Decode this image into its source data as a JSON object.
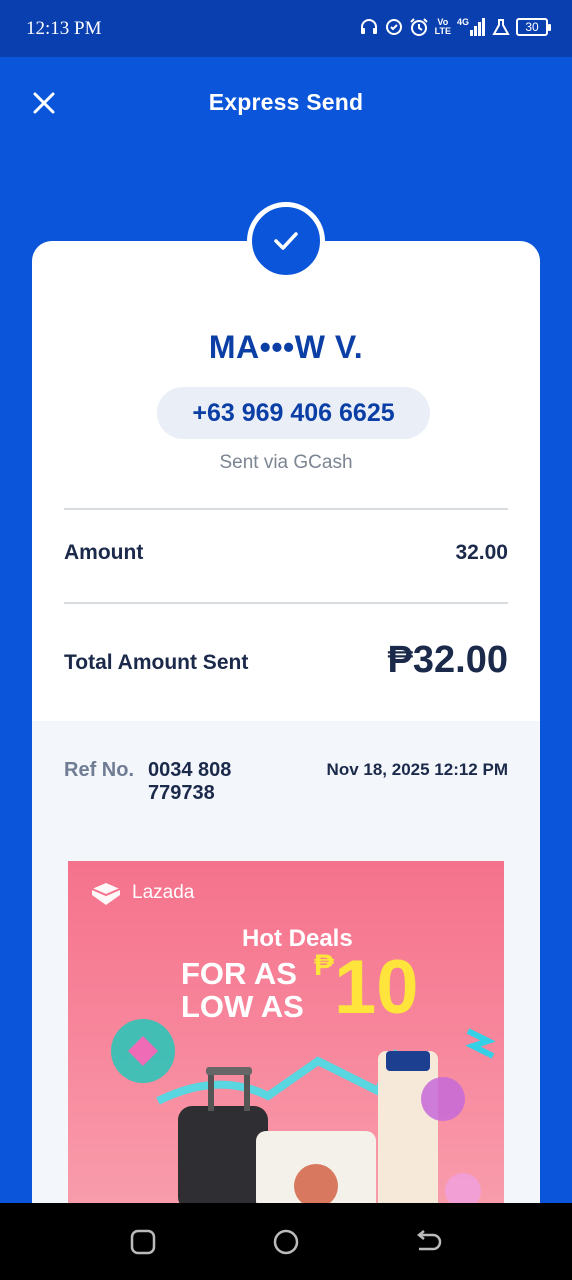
{
  "status_bar": {
    "time": "12:13 PM",
    "battery": "30",
    "net_top": "Vo",
    "net_bottom": "LTE",
    "signal_label": "4G"
  },
  "header": {
    "title": "Express Send"
  },
  "receipt": {
    "recipient_name": "MA•••W V.",
    "phone": "+63 969 406 6625",
    "sent_via": "Sent via GCash",
    "amount_label": "Amount",
    "amount_value": "32.00",
    "total_label": "Total Amount Sent",
    "total_value": "₱32.00",
    "ref_label": "Ref No.",
    "ref_number": "0034 808 779738",
    "date": "Nov 18, 2025 12:12 PM"
  },
  "ad": {
    "brand": "Lazada",
    "headline": "Hot Deals",
    "subheadline": "FOR AS LOW AS",
    "price_currency": "₱",
    "price_value": "10"
  },
  "colors": {
    "brand_blue": "#0a55d9",
    "status_blue": "#0a3fb0",
    "text_dark": "#1b2a4a",
    "accent_yellow": "#ffe53b",
    "ad_pink": "#f5728c"
  },
  "icons": {
    "close": "close-icon",
    "check": "check-icon",
    "back": "back-icon",
    "home": "home-icon",
    "recents": "recents-icon"
  }
}
